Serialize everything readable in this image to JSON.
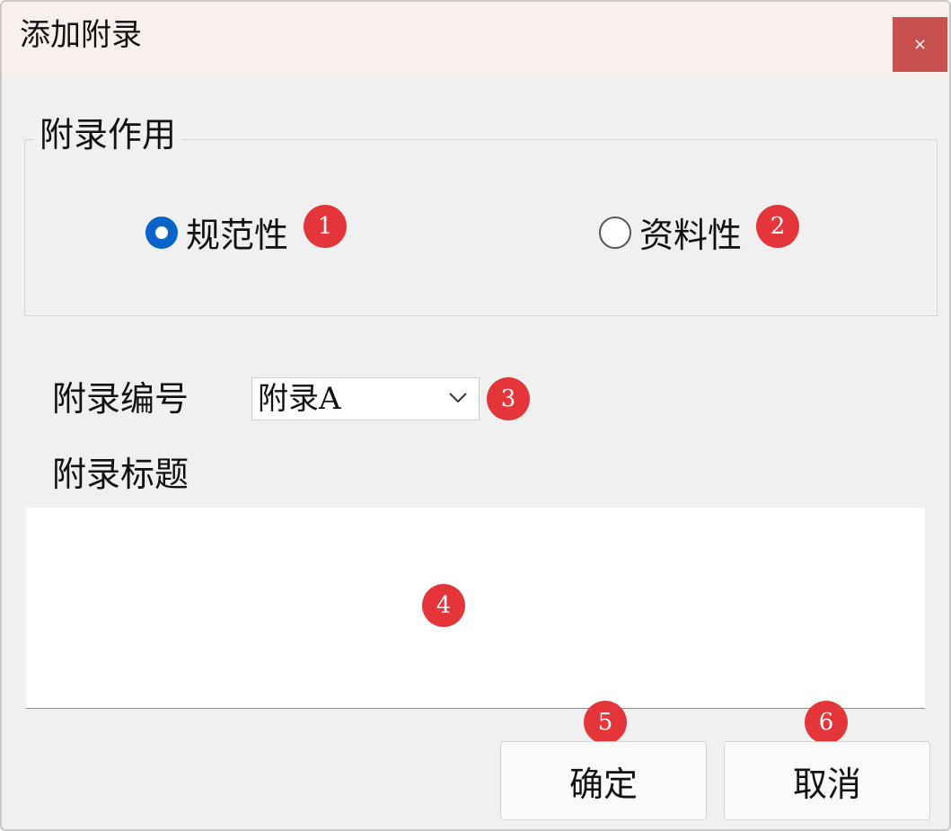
{
  "window": {
    "title": "添加附录",
    "close_label": "×"
  },
  "purpose_group": {
    "legend": "附录作用",
    "options": [
      {
        "label": "规范性",
        "selected": true,
        "badge": "1"
      },
      {
        "label": "资料性",
        "selected": false,
        "badge": "2"
      }
    ]
  },
  "appendix_number": {
    "label": "附录编号",
    "value": "附录A",
    "badge": "3"
  },
  "appendix_title": {
    "label": "附录标题",
    "value": "",
    "badge": "4"
  },
  "buttons": {
    "ok_label": "确定",
    "ok_badge": "5",
    "cancel_label": "取消",
    "cancel_badge": "6"
  },
  "colors": {
    "titlebar": "#f8f0ec",
    "close_button": "#c8514f",
    "radio_selected": "#0864c8",
    "badge": "#e3353a",
    "window_bg": "#f0f0f0"
  }
}
